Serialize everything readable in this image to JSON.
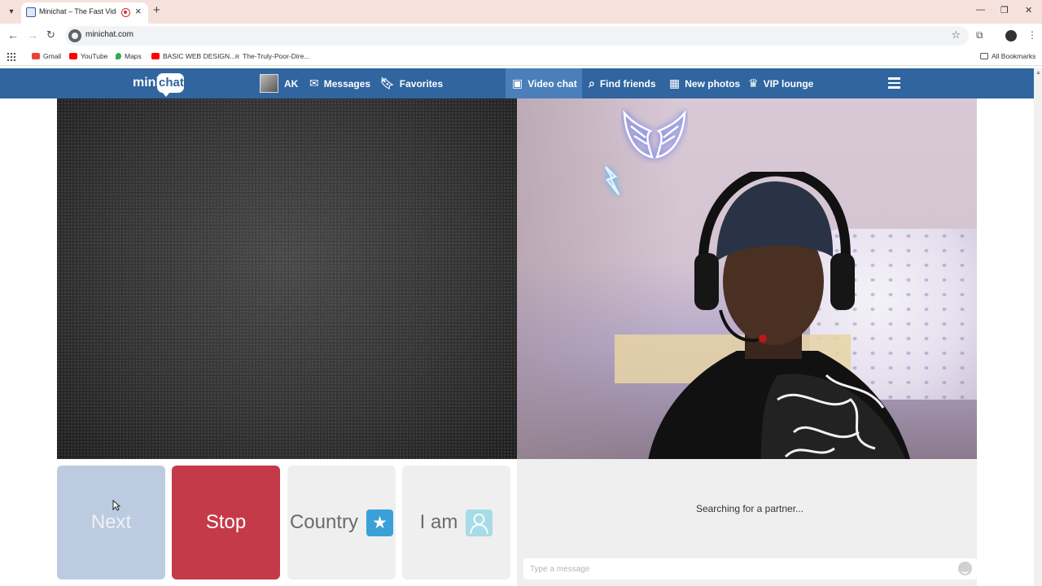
{
  "browser": {
    "tab_title": "Minichat – The Fast Video C",
    "url": "minichat.com",
    "bookmarks": [
      {
        "label": "Gmail",
        "color": "#ea4335"
      },
      {
        "label": "YouTube",
        "color": "#ff0000"
      },
      {
        "label": "Maps",
        "color": "#34a853"
      },
      {
        "label": "BASIC WEB DESIGN...",
        "color": "#ff0000"
      },
      {
        "label": "The-Truly-Poor-Dire...",
        "color": "#555555"
      }
    ],
    "all_bookmarks": "All Bookmarks"
  },
  "site": {
    "logo_mini": "mini",
    "logo_chat": "chat",
    "brand_color": "#30659f",
    "nav": {
      "user": "AK",
      "messages": "Messages",
      "favorites": "Favorites",
      "video_chat": "Video chat",
      "find_friends": "Find friends",
      "new_photos": "New photos",
      "vip_lounge": "VIP lounge"
    }
  },
  "controls": {
    "next": "Next",
    "stop": "Stop",
    "country": "Country",
    "iam": "I am"
  },
  "chat": {
    "status": "Searching for a partner...",
    "placeholder": "Type a message"
  }
}
